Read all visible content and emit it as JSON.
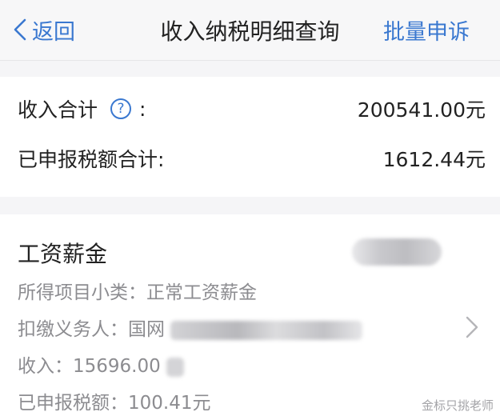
{
  "navbar": {
    "back_label": "返回",
    "title": "收入纳税明细查询",
    "action_label": "批量申诉"
  },
  "summary": {
    "income_label": "收入合计",
    "income_help": "?",
    "income_colon": ":",
    "income_value": "200541.00元",
    "tax_label": "已申报税额合计:",
    "tax_value": "1612.44元"
  },
  "detail": {
    "title": "工资薪金",
    "subcategory": "所得项目小类：正常工资薪金",
    "withholder": "扣缴义务人：国网",
    "income": "收入：15696.00",
    "tax": "已申报税额：100.41元"
  },
  "watermark": "金标只挑老师",
  "colors": {
    "accent": "#3a78d0",
    "secondary_text": "#8c8c90"
  }
}
